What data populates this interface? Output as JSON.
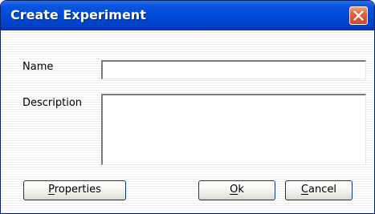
{
  "window": {
    "title": "Create Experiment",
    "close_icon": "close-icon"
  },
  "form": {
    "name_label": "Name",
    "name_value": "",
    "description_label": "Description",
    "description_value": ""
  },
  "buttons": {
    "properties": {
      "mnemonic": "P",
      "rest": "roperties"
    },
    "ok": {
      "mnemonic": "O",
      "rest": "k"
    },
    "cancel": {
      "mnemonic": "C",
      "rest": "ancel"
    }
  },
  "colors": {
    "titlebar": "#0050d8",
    "close_button": "#e35f38",
    "button_border": "#003c74"
  }
}
